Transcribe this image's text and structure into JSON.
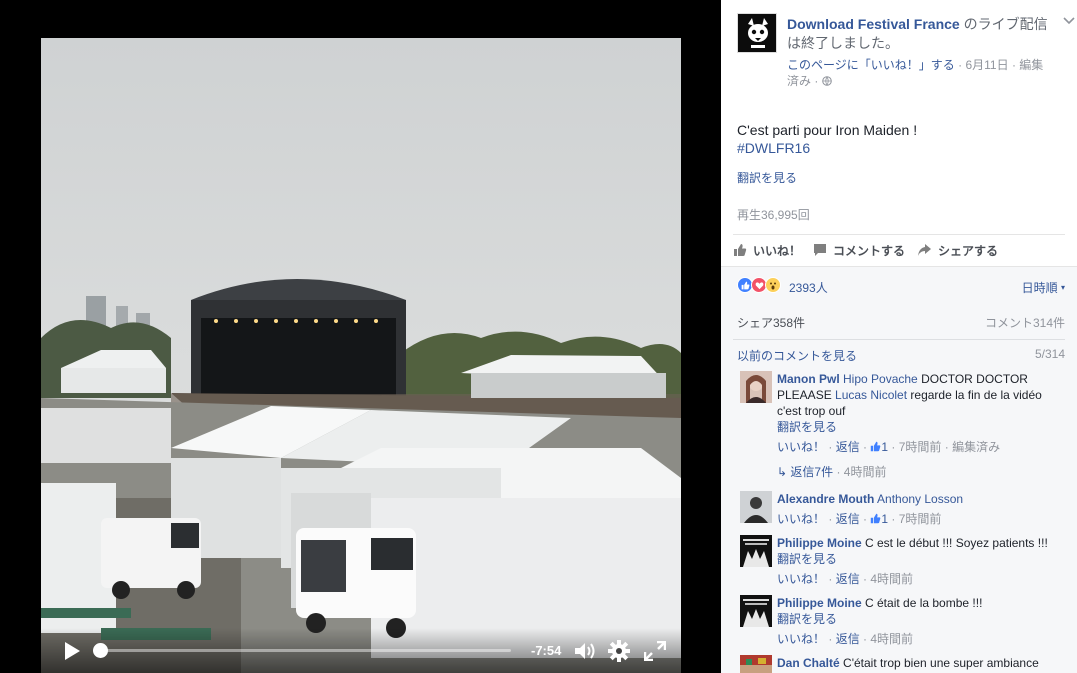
{
  "video": {
    "time_remaining": "-7:54",
    "progress": 0.0
  },
  "post": {
    "page_name": "Download Festival France",
    "header_suffix": "のライブ配信は終了しました。",
    "like_page": "このページに「いいね！」する",
    "date": "6月11日",
    "edited": "編集済み",
    "message": "C'est parti pour Iron Maiden !",
    "hashtag": "#DWLFR16",
    "see_translation": "翻訳を見る",
    "views": "再生36,995回"
  },
  "actions": {
    "like": "いいね！",
    "comment": "コメントする",
    "share": "シェアする"
  },
  "reactions": {
    "icons": [
      "like-icon",
      "love-icon",
      "wow-icon"
    ],
    "count": "2393人",
    "sort": "日時順"
  },
  "stats": {
    "shares": "シェア358件",
    "comments": "コメント314件",
    "previous": "以前のコメントを見る",
    "pager": "5/314"
  },
  "comments": [
    {
      "author": "Manon Pwl",
      "mention1": "Hipo Povache",
      "text1": " DOCTOR DOCTOR PLEAASE ",
      "mention2": "Lucas Nicolet",
      "text2": " regarde la fin de la vidéo c'est trop ouf",
      "translate": "翻訳を見る",
      "like": "いいね！",
      "reply": "返信",
      "likes": "1",
      "time": "7時間前",
      "edited": "編集済み",
      "replies_label": "返信7件",
      "replies_time": "4時間前"
    },
    {
      "author": "Alexandre Mouth",
      "mention1": "Anthony Losson",
      "like": "いいね！",
      "reply": "返信",
      "likes": "1",
      "time": "7時間前"
    },
    {
      "author": "Philippe Moine",
      "text1": " C est le début !!! Soyez patients !!!",
      "translate": "翻訳を見る",
      "like": "いいね！",
      "reply": "返信",
      "time": "4時間前"
    },
    {
      "author": "Philippe Moine",
      "text1": " C était de la bombe !!!",
      "translate": "翻訳を見る",
      "like": "いいね！",
      "reply": "返信",
      "time": "4時間前"
    },
    {
      "author": "Dan Chalté",
      "text1": " C'était trop bien une super ambiance"
    }
  ],
  "colors": {
    "link": "#365899",
    "muted": "#90949c",
    "like_blue": "#4080ff",
    "love_red": "#f25268",
    "wow_yellow": "#fcd05a"
  }
}
